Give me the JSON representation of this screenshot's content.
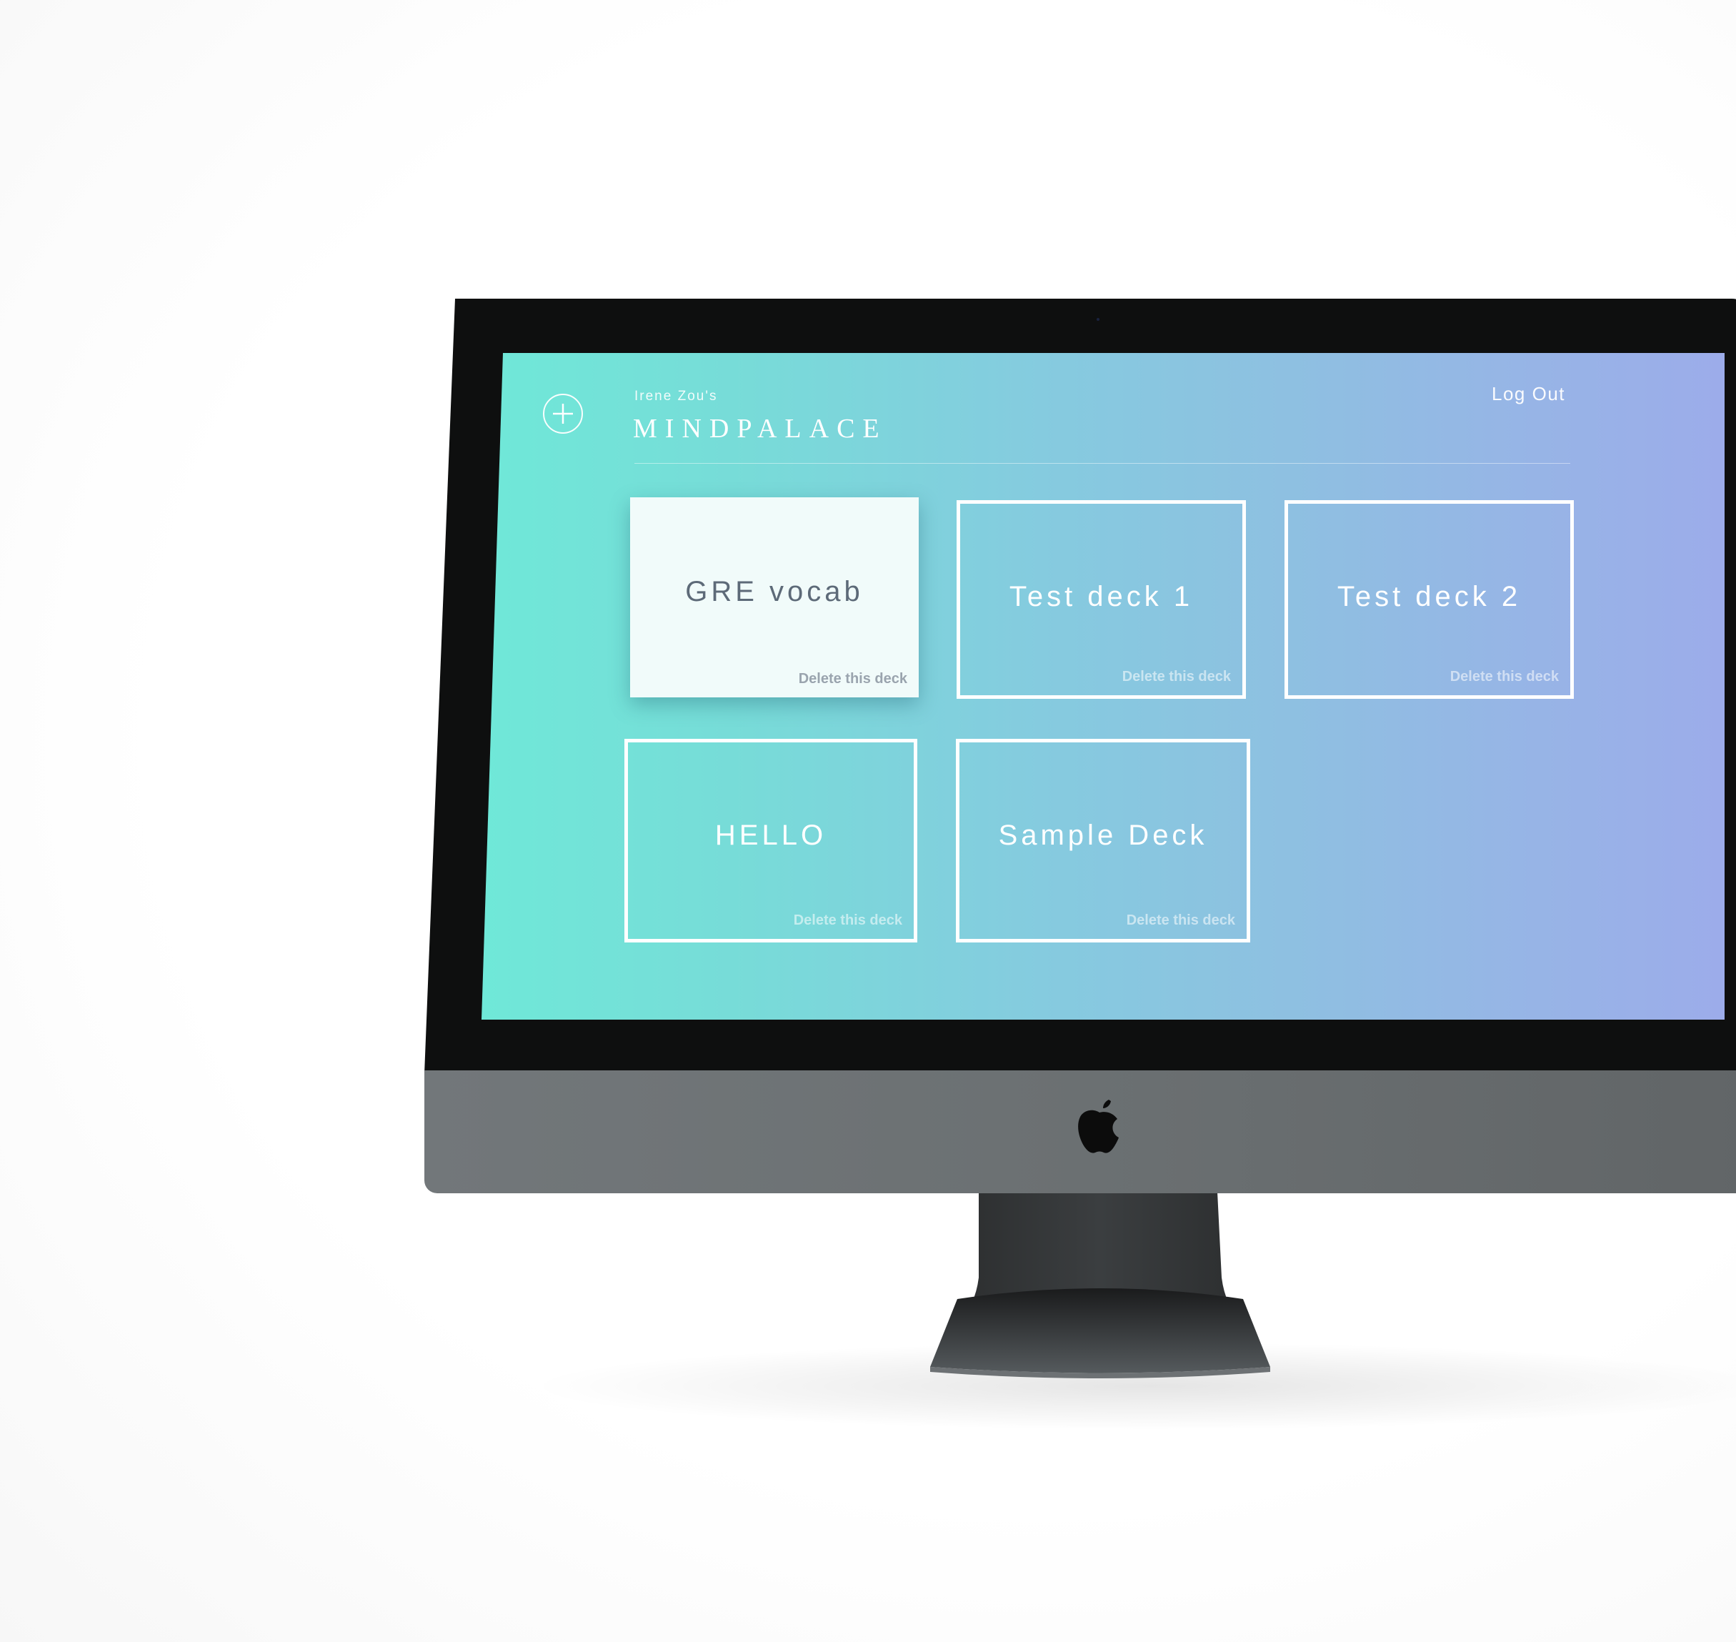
{
  "app": {
    "owner_label": "Irene Zou's",
    "brand_name": "MINDPALACE",
    "logout_label": "Log Out",
    "add_icon": "plus-circle-icon"
  },
  "decks": [
    {
      "title": "GRE vocab",
      "delete_label": "Delete this deck",
      "state": "hovered"
    },
    {
      "title": "Test deck 1",
      "delete_label": "Delete this deck",
      "state": "default"
    },
    {
      "title": "Test deck 2",
      "delete_label": "Delete this deck",
      "state": "default"
    },
    {
      "title": "HELLO",
      "delete_label": "Delete this deck",
      "state": "default"
    },
    {
      "title": "Sample Deck",
      "delete_label": "Delete this deck",
      "state": "default"
    }
  ],
  "theme": {
    "gradient_start": "#6fe8d8",
    "gradient_end": "#9cacea",
    "active_card_bg": "#f1fbfa",
    "active_title_color": "#5d6a78"
  },
  "device": {
    "type": "desktop-monitor",
    "logo_icon": "apple-logo-icon"
  }
}
